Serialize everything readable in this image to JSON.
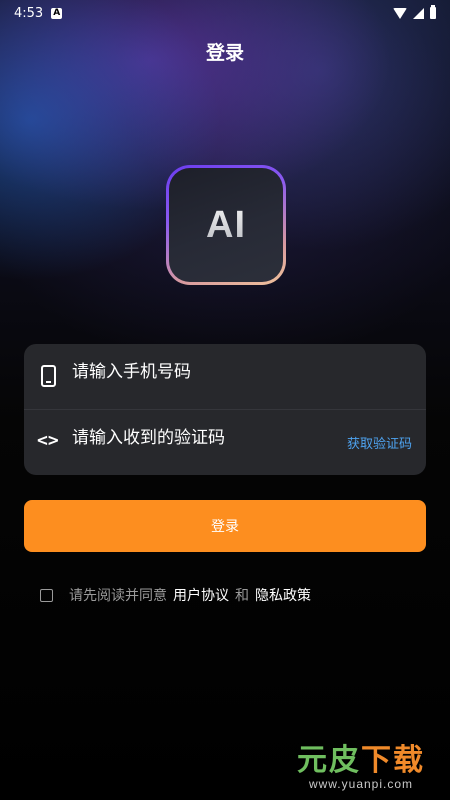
{
  "status_bar": {
    "time": "4:53",
    "notification_letter": "A"
  },
  "header": {
    "title": "登录"
  },
  "logo": {
    "text": "AI"
  },
  "form": {
    "phone_placeholder": "请输入手机号码",
    "code_placeholder": "请输入收到的验证码",
    "get_code_label": "获取验证码",
    "code_icon_glyph": "<>"
  },
  "login_button": {
    "label": "登录"
  },
  "agreement": {
    "prefix": "请先阅读并同意",
    "user_agreement": "用户协议",
    "conjunction": "和",
    "privacy_policy": "隐私政策"
  },
  "watermark": {
    "title_part1": "元皮",
    "title_part2": "下载",
    "url": "www.yuanpi.com"
  },
  "colors": {
    "accent_orange": "#fd8e1f",
    "link_blue": "#4ea3f0",
    "card_bg": "#27282c"
  }
}
